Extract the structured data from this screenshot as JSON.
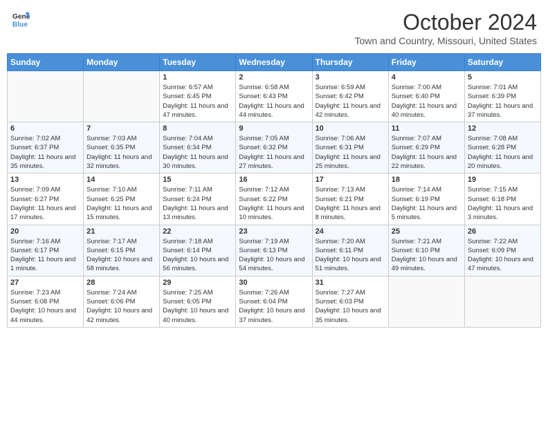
{
  "header": {
    "logo_general": "General",
    "logo_blue": "Blue",
    "month_title": "October 2024",
    "location": "Town and Country, Missouri, United States"
  },
  "days_of_week": [
    "Sunday",
    "Monday",
    "Tuesday",
    "Wednesday",
    "Thursday",
    "Friday",
    "Saturday"
  ],
  "weeks": [
    [
      {
        "day": "",
        "info": ""
      },
      {
        "day": "",
        "info": ""
      },
      {
        "day": "1",
        "info": "Sunrise: 6:57 AM\nSunset: 6:45 PM\nDaylight: 11 hours and 47 minutes."
      },
      {
        "day": "2",
        "info": "Sunrise: 6:58 AM\nSunset: 6:43 PM\nDaylight: 11 hours and 44 minutes."
      },
      {
        "day": "3",
        "info": "Sunrise: 6:59 AM\nSunset: 6:42 PM\nDaylight: 11 hours and 42 minutes."
      },
      {
        "day": "4",
        "info": "Sunrise: 7:00 AM\nSunset: 6:40 PM\nDaylight: 11 hours and 40 minutes."
      },
      {
        "day": "5",
        "info": "Sunrise: 7:01 AM\nSunset: 6:39 PM\nDaylight: 11 hours and 37 minutes."
      }
    ],
    [
      {
        "day": "6",
        "info": "Sunrise: 7:02 AM\nSunset: 6:37 PM\nDaylight: 11 hours and 35 minutes."
      },
      {
        "day": "7",
        "info": "Sunrise: 7:03 AM\nSunset: 6:35 PM\nDaylight: 11 hours and 32 minutes."
      },
      {
        "day": "8",
        "info": "Sunrise: 7:04 AM\nSunset: 6:34 PM\nDaylight: 11 hours and 30 minutes."
      },
      {
        "day": "9",
        "info": "Sunrise: 7:05 AM\nSunset: 6:32 PM\nDaylight: 11 hours and 27 minutes."
      },
      {
        "day": "10",
        "info": "Sunrise: 7:06 AM\nSunset: 6:31 PM\nDaylight: 11 hours and 25 minutes."
      },
      {
        "day": "11",
        "info": "Sunrise: 7:07 AM\nSunset: 6:29 PM\nDaylight: 11 hours and 22 minutes."
      },
      {
        "day": "12",
        "info": "Sunrise: 7:08 AM\nSunset: 6:28 PM\nDaylight: 11 hours and 20 minutes."
      }
    ],
    [
      {
        "day": "13",
        "info": "Sunrise: 7:09 AM\nSunset: 6:27 PM\nDaylight: 11 hours and 17 minutes."
      },
      {
        "day": "14",
        "info": "Sunrise: 7:10 AM\nSunset: 6:25 PM\nDaylight: 11 hours and 15 minutes."
      },
      {
        "day": "15",
        "info": "Sunrise: 7:11 AM\nSunset: 6:24 PM\nDaylight: 11 hours and 13 minutes."
      },
      {
        "day": "16",
        "info": "Sunrise: 7:12 AM\nSunset: 6:22 PM\nDaylight: 11 hours and 10 minutes."
      },
      {
        "day": "17",
        "info": "Sunrise: 7:13 AM\nSunset: 6:21 PM\nDaylight: 11 hours and 8 minutes."
      },
      {
        "day": "18",
        "info": "Sunrise: 7:14 AM\nSunset: 6:19 PM\nDaylight: 11 hours and 5 minutes."
      },
      {
        "day": "19",
        "info": "Sunrise: 7:15 AM\nSunset: 6:18 PM\nDaylight: 11 hours and 3 minutes."
      }
    ],
    [
      {
        "day": "20",
        "info": "Sunrise: 7:16 AM\nSunset: 6:17 PM\nDaylight: 11 hours and 1 minute."
      },
      {
        "day": "21",
        "info": "Sunrise: 7:17 AM\nSunset: 6:15 PM\nDaylight: 10 hours and 58 minutes."
      },
      {
        "day": "22",
        "info": "Sunrise: 7:18 AM\nSunset: 6:14 PM\nDaylight: 10 hours and 56 minutes."
      },
      {
        "day": "23",
        "info": "Sunrise: 7:19 AM\nSunset: 6:13 PM\nDaylight: 10 hours and 54 minutes."
      },
      {
        "day": "24",
        "info": "Sunrise: 7:20 AM\nSunset: 6:11 PM\nDaylight: 10 hours and 51 minutes."
      },
      {
        "day": "25",
        "info": "Sunrise: 7:21 AM\nSunset: 6:10 PM\nDaylight: 10 hours and 49 minutes."
      },
      {
        "day": "26",
        "info": "Sunrise: 7:22 AM\nSunset: 6:09 PM\nDaylight: 10 hours and 47 minutes."
      }
    ],
    [
      {
        "day": "27",
        "info": "Sunrise: 7:23 AM\nSunset: 6:08 PM\nDaylight: 10 hours and 44 minutes."
      },
      {
        "day": "28",
        "info": "Sunrise: 7:24 AM\nSunset: 6:06 PM\nDaylight: 10 hours and 42 minutes."
      },
      {
        "day": "29",
        "info": "Sunrise: 7:25 AM\nSunset: 6:05 PM\nDaylight: 10 hours and 40 minutes."
      },
      {
        "day": "30",
        "info": "Sunrise: 7:26 AM\nSunset: 6:04 PM\nDaylight: 10 hours and 37 minutes."
      },
      {
        "day": "31",
        "info": "Sunrise: 7:27 AM\nSunset: 6:03 PM\nDaylight: 10 hours and 35 minutes."
      },
      {
        "day": "",
        "info": ""
      },
      {
        "day": "",
        "info": ""
      }
    ]
  ]
}
